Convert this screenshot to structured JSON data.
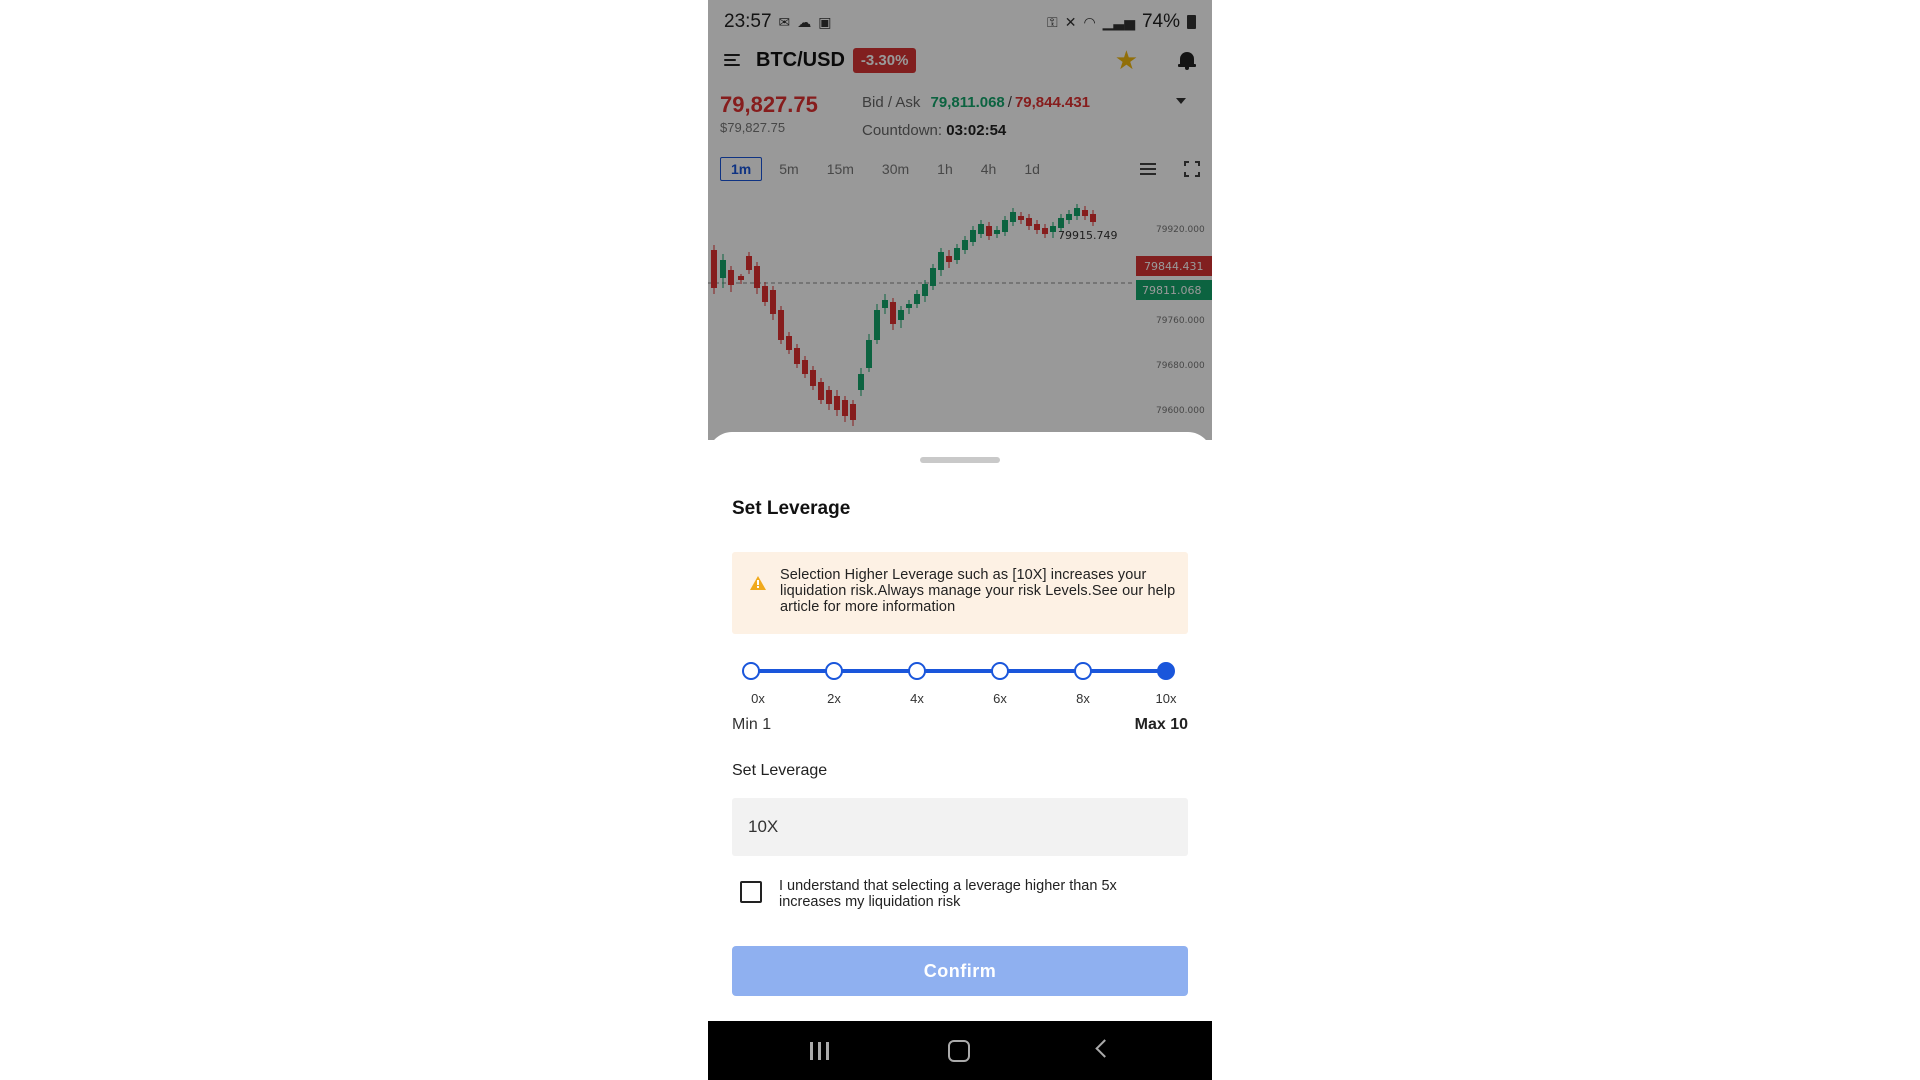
{
  "status_bar": {
    "time": "23:57",
    "battery": "74%",
    "left_icons": [
      "gmail-icon",
      "cloud-icon",
      "image-icon"
    ],
    "right_icons": [
      "key-icon",
      "mute-icon",
      "wifi-icon",
      "signal-icon",
      "volte-icon",
      "signal-icon-2",
      "battery-icon"
    ]
  },
  "header": {
    "pair": "BTC/USD",
    "change": "-3.30%",
    "change_color": "#d83535"
  },
  "price_panel": {
    "last_price": "79,827.75",
    "fiat_price": "$79,827.75",
    "bid_ask_label": "Bid / Ask",
    "bid": "79,811.068",
    "separator": "/",
    "ask": "79,844.431",
    "countdown_label": "Countdown:",
    "countdown_value": "03:02:54"
  },
  "timeframes": {
    "items": [
      "1m",
      "5m",
      "15m",
      "30m",
      "1h",
      "4h",
      "1d"
    ],
    "selected": "1m"
  },
  "chart": {
    "high_marker": "79915.749",
    "ask_tag": "79844.431",
    "bid_tag": "79811.068",
    "y_ticks": [
      "79920.000",
      "79760.000",
      "79680.000",
      "79600.000"
    ],
    "up_color": "#14a56c",
    "down_color": "#e03131"
  },
  "leverage_sheet": {
    "title": "Set Leverage",
    "warning": "Selection Higher Leverage such as [10X] increases your liquidation risk.Always manage your risk Levels.See our help article for more information",
    "slider_stops": [
      "0x",
      "2x",
      "4x",
      "6x",
      "8x",
      "10x"
    ],
    "slider_selected": "10x",
    "min_label": "Min 1",
    "max_label": "Max 10",
    "field_label": "Set Leverage",
    "input_value": "10X",
    "ack_text": "I understand that selecting a leverage higher than 5x increases my liquidation risk",
    "ack_checked": false,
    "confirm_label": "Confirm",
    "accent_color": "#1a56db"
  },
  "nav_bar": {
    "icons": [
      "recents-icon",
      "home-icon",
      "back-icon"
    ]
  }
}
